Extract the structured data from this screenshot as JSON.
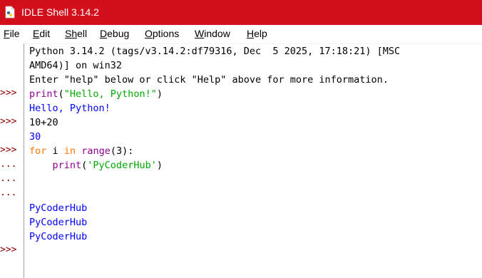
{
  "window": {
    "title": "IDLE Shell 3.14.2",
    "icon": "python-file-icon",
    "title_bar_color": "#d40f1c"
  },
  "menu": [
    {
      "label_first": "F",
      "label_rest": "ile"
    },
    {
      "label_first": "E",
      "label_rest": "dit"
    },
    {
      "label_first": "Sh",
      "label_rest": "ell"
    },
    {
      "label_first": "D",
      "label_rest": "ebug"
    },
    {
      "label_first": "O",
      "label_rest": "ptions"
    },
    {
      "label_first": "W",
      "label_rest": "indow"
    },
    {
      "label_first": "H",
      "label_rest": "elp"
    }
  ],
  "prompts": [
    ">>>",
    ">>>",
    ">>>",
    "...",
    "...",
    "...",
    ">>>"
  ],
  "shell": {
    "banner_line1": "Python 3.14.2 (tags/v3.14.2:df79316, Dec  5 2025, 17:18:21) [MSC",
    "banner_line2": "AMD64)] on win32",
    "banner_line3": "Enter \"help\" below or click \"Help\" above for more information.",
    "cmd1_func": "print",
    "cmd1_open": "(",
    "cmd1_str": "\"Hello, Python!\"",
    "cmd1_close": ")",
    "out1": "Hello, Python!",
    "cmd2": "10+20",
    "out2": "30",
    "cmd3_kw1": "for",
    "cmd3_var": " i ",
    "cmd3_kw2": "in",
    "cmd3_sp": " ",
    "cmd3_func": "range",
    "cmd3_rest": "(3):",
    "cmd4_indent": "    ",
    "cmd4_func": "print",
    "cmd4_open": "(",
    "cmd4_str": "'PyCoderHub'",
    "cmd4_close": ")",
    "out3a": "PyCoderHub",
    "out3b": "PyCoderHub",
    "out3c": "PyCoderHub"
  },
  "colors": {
    "prompt": "#8b0000",
    "builtin": "#900090",
    "string": "#00aa00",
    "keyword": "#ff7700",
    "output": "#0000ff"
  }
}
